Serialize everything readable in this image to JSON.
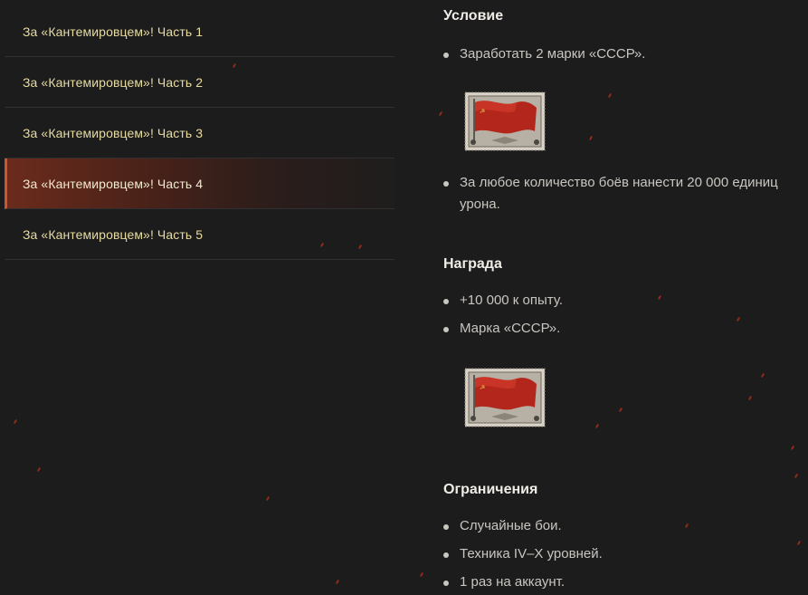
{
  "sidebar": {
    "items": [
      {
        "label": "За «Кантемировцем»! Часть 1",
        "active": false
      },
      {
        "label": "За «Кантемировцем»! Часть 2",
        "active": false
      },
      {
        "label": "За «Кантемировцем»! Часть 3",
        "active": false
      },
      {
        "label": "За «Кантемировцем»! Часть 4",
        "active": true
      },
      {
        "label": "За «Кантемировцем»! Часть 5",
        "active": false
      }
    ]
  },
  "condition": {
    "title": "Условие",
    "items": [
      "Заработать 2 марки «СССР».",
      "За любое количество боёв нанести 20 000 единиц урона."
    ]
  },
  "reward": {
    "title": "Награда",
    "items": [
      "+10 000 к опыту.",
      "Марка «СССР»."
    ]
  },
  "restrictions": {
    "title": "Ограничения",
    "items": [
      "Случайные бои.",
      "Техника IV–X уровней.",
      "1 раз на аккаунт."
    ]
  },
  "icons": {
    "stamp": "ussr-flag-stamp-icon"
  },
  "colors": {
    "background": "#1c1c1d",
    "sidebar_text": "#e8dca0",
    "active_accent": "#d0542c",
    "body_text": "#c9c6c0",
    "heading": "#f0ede6"
  }
}
